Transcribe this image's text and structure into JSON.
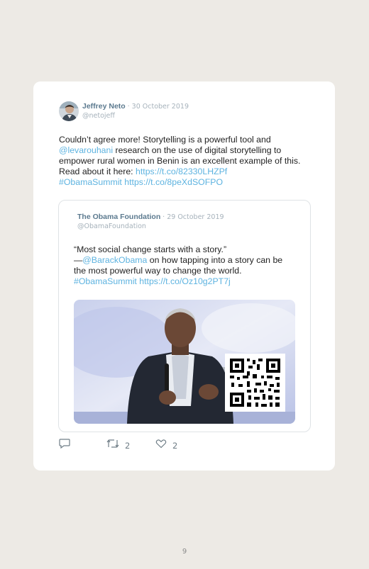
{
  "tweet": {
    "author_name": "Jeffrey Neto",
    "date": "· 30 October 2019",
    "handle": "@netojeff",
    "text_1": "Couldn’t agree more! Storytelling is a powerful tool and ",
    "mention": "@levarouhani",
    "text_2": " research on the use of digital storytelling to empower rural women in Benin is an excellent example of this. Read about it here: ",
    "link_1": "https://t.co/82330LHZPf",
    "hashtag": "#ObamaSummit",
    "link_2": "https://t.co/8peXdSOFPO"
  },
  "quoted": {
    "author_name": "The Obama Foundation",
    "date": "· 29 October 2019",
    "handle": "@ObamaFoundation",
    "text_1": "“Most social change starts with a story.”",
    "dash": "—",
    "mention": "@BarackObama",
    "text_2": " on how tapping into a story can be the most powerful way to change the world.",
    "hashtag": "#ObamaSummit",
    "link": "https://t.co/Oz10g2PT7j"
  },
  "actions": {
    "reply_icon": "reply-icon",
    "retweet_icon": "retweet-icon",
    "retweet_count": "2",
    "like_icon": "heart-icon",
    "like_count": "2"
  },
  "page_number": "9"
}
